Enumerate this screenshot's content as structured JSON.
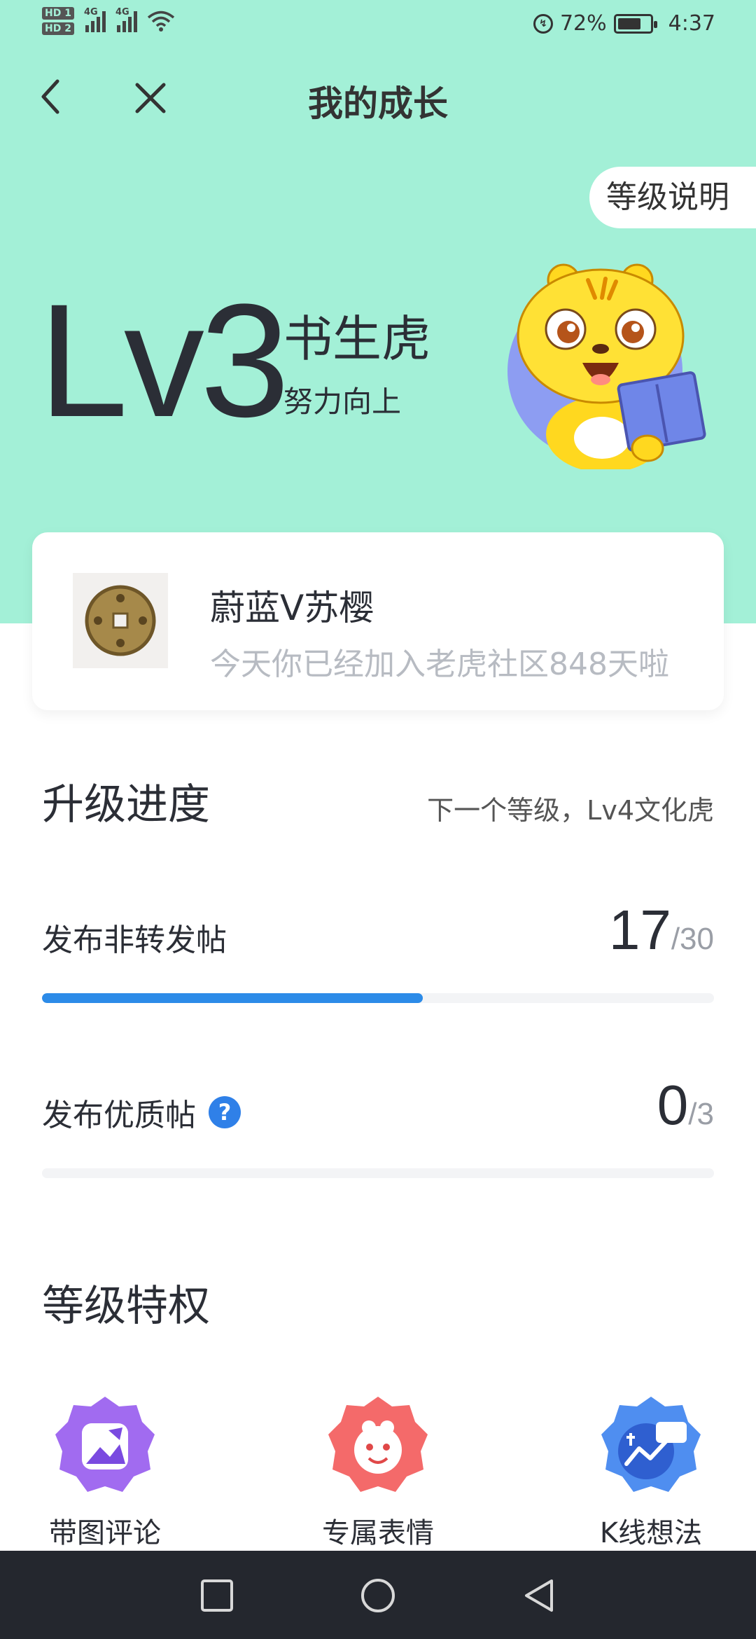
{
  "status_bar": {
    "hd1": "HD 1",
    "hd2": "HD 2",
    "net1": "4G",
    "net2": "4G",
    "battery_percent": "72%",
    "battery_level": 0.72,
    "time": "4:37"
  },
  "nav": {
    "title": "我的成长",
    "back_icon": "chevron-left-icon",
    "close_icon": "close-icon"
  },
  "level": {
    "number": "Lv3",
    "name": "书生虎",
    "tagline": "努力向上",
    "desc_button": "等级说明"
  },
  "profile": {
    "username": "蔚蓝V苏樱",
    "joined_text": "今天你已经加入老虎社区848天啦"
  },
  "progress": {
    "title": "升级进度",
    "next_level": "下一个等级，Lv4文化虎",
    "tasks": [
      {
        "label": "发布非转发帖",
        "current": "17",
        "total": "/30",
        "fraction": 0.567
      },
      {
        "label": "发布优质帖",
        "current": "0",
        "total": "/3",
        "fraction": 0,
        "help_icon": "?"
      }
    ]
  },
  "privileges": {
    "title": "等级特权",
    "items": [
      {
        "label": "带图评论",
        "icon": "image-comment-icon"
      },
      {
        "label": "专属表情",
        "icon": "sticker-icon"
      },
      {
        "label": "K线想法",
        "icon": "kline-idea-icon"
      }
    ]
  },
  "colors": {
    "hero_bg": "#a3f0d7",
    "progress_fill": "#2c8be8",
    "nav_bar": "#24272e"
  }
}
